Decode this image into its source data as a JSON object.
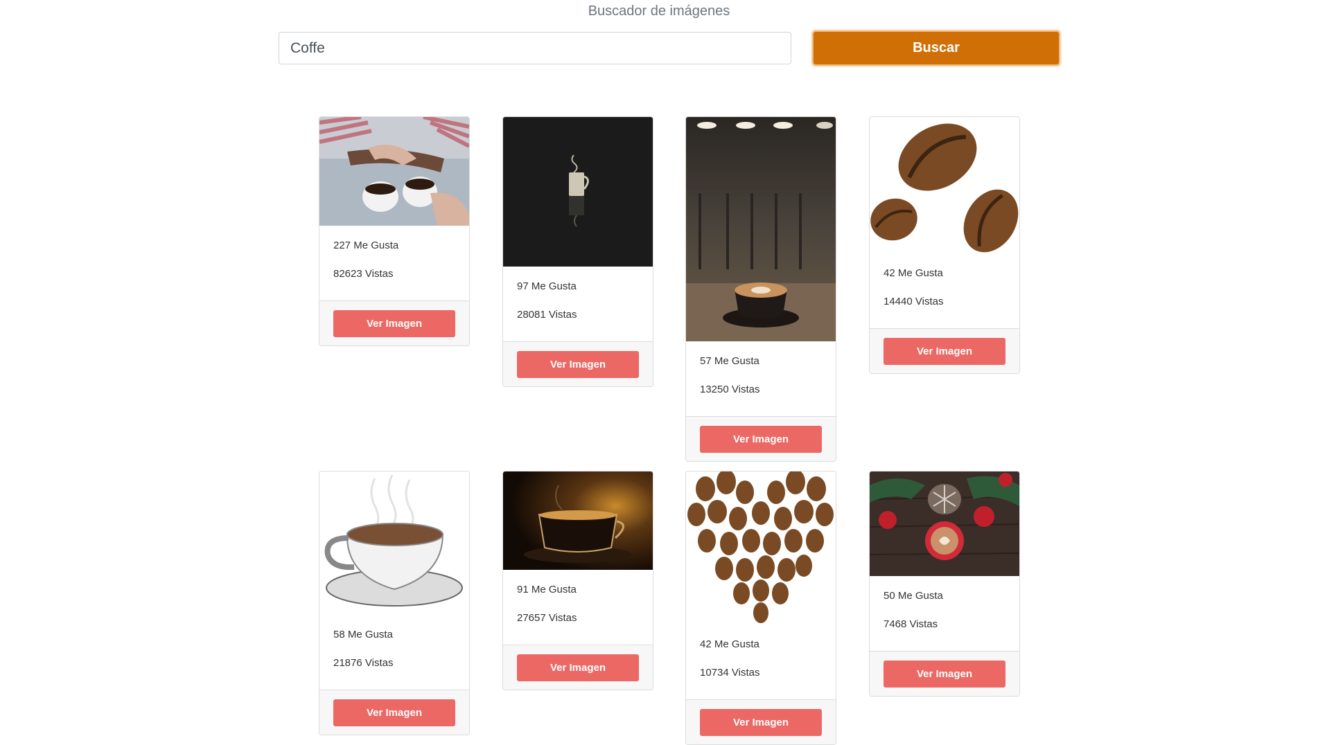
{
  "header": {
    "title": "Buscador de imágenes"
  },
  "search": {
    "value": "Coffe",
    "button_label": "Buscar"
  },
  "accent_colors": {
    "search_button": "#d06f05",
    "view_button": "#eb6864"
  },
  "cards": [
    {
      "image": "hands-holding-coffee-cups",
      "likes": "227 Me Gusta",
      "views": "82623 Vistas",
      "button_label": "Ver Imagen"
    },
    {
      "image": "steaming-metal-mug-dark",
      "likes": "97 Me Gusta",
      "views": "28081 Vistas",
      "button_label": "Ver Imagen"
    },
    {
      "image": "latte-cup-in-cafe",
      "likes": "57 Me Gusta",
      "views": "13250 Vistas",
      "button_label": "Ver Imagen"
    },
    {
      "image": "three-coffee-beans",
      "likes": "42 Me Gusta",
      "views": "14440 Vistas",
      "button_label": "Ver Imagen"
    },
    {
      "image": "white-coffee-cup-on-saucer",
      "likes": "58 Me Gusta",
      "views": "21876 Vistas",
      "button_label": "Ver Imagen"
    },
    {
      "image": "espresso-glass-cup",
      "likes": "91 Me Gusta",
      "views": "27657 Vistas",
      "button_label": "Ver Imagen"
    },
    {
      "image": "coffee-bean-heart",
      "likes": "42 Me Gusta",
      "views": "10734 Vistas",
      "button_label": "Ver Imagen"
    },
    {
      "image": "christmas-latte-with-apples",
      "likes": "50 Me Gusta",
      "views": "7468 Vistas",
      "button_label": "Ver Imagen"
    }
  ]
}
